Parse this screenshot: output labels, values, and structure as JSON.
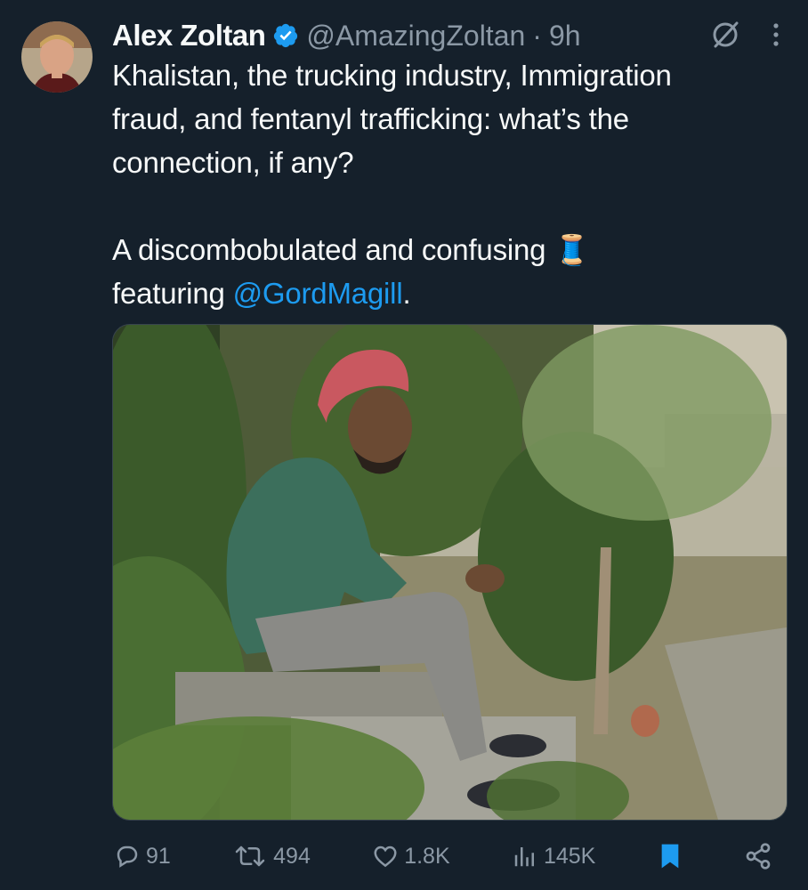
{
  "tweet": {
    "author": {
      "display_name": "Alex Zoltan",
      "handle": "@AmazingZoltan",
      "verified": true,
      "verified_color": "#1d9bf0"
    },
    "separator": "·",
    "time": "9h",
    "text_lines": [
      "Khalistan, the trucking industry, Immigration",
      "fraud, and fentanyl trafficking: what’s the",
      "connection, if any?"
    ],
    "text_line4_before": "A discombobulated and confusing ",
    "thread_emoji": "🧵",
    "text_line5_before": "featuring ",
    "mention": "@GordMagill",
    "text_line5_after": ".",
    "icons": {
      "grok": "grok-icon",
      "more": "more-options-icon",
      "thread": "thread-spool-icon"
    }
  },
  "actions": {
    "replies": "91",
    "reposts": "494",
    "likes": "1.8K",
    "views": "145K"
  },
  "colors": {
    "background": "#15202b",
    "text": "#f7f9f9",
    "secondary": "#8b98a5",
    "accent": "#1d9bf0"
  }
}
